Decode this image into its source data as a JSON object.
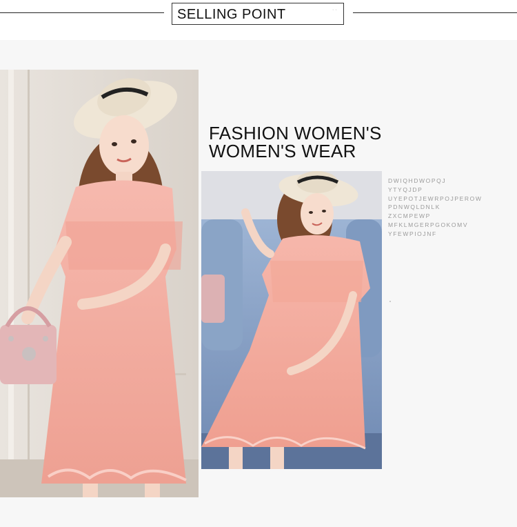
{
  "header": {
    "title": "SELLING POINT"
  },
  "heading": {
    "line1": "FASHION WOMEN'S",
    "line2": "WOMEN'S WEAR"
  },
  "descriptor_lines": [
    "DWIQHDWOPQJ",
    "YTYQJDP",
    "UYEPOTJEWRPOJPEROW",
    "PDNWQLDNLK",
    "ZXCMPEWP",
    "MFKLMGERPGOKOMV",
    "YFEWPIOJNF"
  ],
  "colors": {
    "dress_pink": "#f3aaa0",
    "sofa_blue": "#7f9ac0",
    "hat_cream": "#efe6d6"
  }
}
